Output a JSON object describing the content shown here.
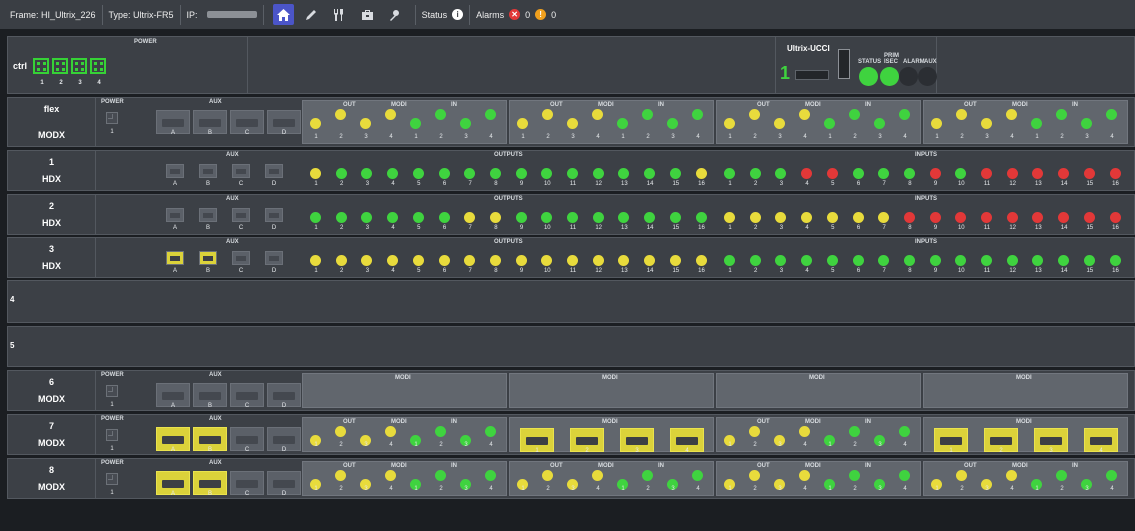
{
  "topbar": {
    "frame": "Frame: HI_Ultrix_226",
    "type": "Type: Ultrix-FR5",
    "ip_label": "IP:",
    "status_label": "Status",
    "alarms_label": "Alarms",
    "alarm_red_count": "0",
    "alarm_yellow_count": "0",
    "tools": [
      "home-icon",
      "pen-icon",
      "wrench-icon",
      "toolbox-icon",
      "tuner-icon"
    ]
  },
  "ctrl": {
    "label": "ctrl",
    "power_label": "POWER",
    "slots": [
      "1",
      "2",
      "3",
      "4"
    ],
    "ucci_title": "Ultrix-UCCI",
    "ucci_number": "1",
    "status_label": "STATUS",
    "prim_label": "PRIM",
    "isec_label": "ISEC",
    "alarm_label": "ALARM",
    "aux_label": "AUX"
  },
  "labels": {
    "power": "POWER",
    "aux": "AUX",
    "out": "OUT",
    "modi": "MODI",
    "in": "IN",
    "outputs": "OUTPUTS",
    "inputs": "INPUTS",
    "bay_letters": [
      "A",
      "B",
      "C",
      "D"
    ]
  },
  "slots": [
    {
      "id": "flex",
      "card": "MODX",
      "kind": "modx",
      "aux": [
        "n",
        "n",
        "n",
        "n"
      ],
      "groups": [
        {
          "kind": "leds",
          "leds": [
            "y",
            "y",
            "y",
            "y",
            "g",
            "g",
            "g",
            "g"
          ]
        },
        {
          "kind": "leds",
          "leds": [
            "y",
            "y",
            "y",
            "y",
            "g",
            "g",
            "g",
            "g"
          ]
        },
        {
          "kind": "leds",
          "leds": [
            "y",
            "y",
            "y",
            "y",
            "g",
            "g",
            "g",
            "g"
          ]
        },
        {
          "kind": "leds",
          "leds": [
            "y",
            "y",
            "y",
            "y",
            "g",
            "g",
            "g",
            "g"
          ]
        }
      ]
    },
    {
      "id": "1",
      "card": "HDX",
      "kind": "hdx",
      "aux": [
        "n",
        "n",
        "n",
        "n"
      ],
      "outputs": [
        "y",
        "g",
        "g",
        "g",
        "g",
        "g",
        "g",
        "g",
        "g",
        "g",
        "g",
        "g",
        "g",
        "g",
        "g",
        "y"
      ],
      "inputs": [
        "g",
        "g",
        "g",
        "r",
        "r",
        "g",
        "g",
        "g",
        "r",
        "g",
        "r",
        "r",
        "r",
        "r",
        "r",
        "r"
      ]
    },
    {
      "id": "2",
      "card": "HDX",
      "kind": "hdx",
      "aux": [
        "n",
        "n",
        "n",
        "n"
      ],
      "outputs": [
        "g",
        "g",
        "g",
        "g",
        "g",
        "g",
        "y",
        "y",
        "g",
        "g",
        "g",
        "g",
        "g",
        "g",
        "g",
        "g"
      ],
      "inputs": [
        "y",
        "y",
        "y",
        "y",
        "y",
        "y",
        "y",
        "r",
        "r",
        "r",
        "r",
        "r",
        "r",
        "r",
        "r",
        "r"
      ]
    },
    {
      "id": "3",
      "card": "HDX",
      "kind": "hdx",
      "aux": [
        "y",
        "y",
        "n",
        "n"
      ],
      "outputs": [
        "y",
        "y",
        "y",
        "y",
        "y",
        "y",
        "y",
        "y",
        "y",
        "y",
        "y",
        "y",
        "y",
        "y",
        "y",
        "y"
      ],
      "inputs": [
        "g",
        "g",
        "g",
        "g",
        "g",
        "g",
        "g",
        "g",
        "g",
        "g",
        "g",
        "g",
        "g",
        "g",
        "g",
        "g"
      ]
    },
    {
      "id": "4",
      "kind": "empty"
    },
    {
      "id": "5",
      "kind": "empty"
    },
    {
      "id": "6",
      "card": "MODX",
      "kind": "modx",
      "aux": [
        "n",
        "n",
        "n",
        "n"
      ],
      "groups": [
        {
          "kind": "blank"
        },
        {
          "kind": "blank"
        },
        {
          "kind": "blank"
        },
        {
          "kind": "blank"
        }
      ]
    },
    {
      "id": "7",
      "card": "MODX",
      "kind": "modx",
      "aux": [
        "y",
        "y",
        "n",
        "n"
      ],
      "groups": [
        {
          "kind": "leds",
          "leds": [
            "y",
            "y",
            "y",
            "y",
            "g",
            "g",
            "g",
            "g"
          ]
        },
        {
          "kind": "bays"
        },
        {
          "kind": "leds",
          "leds": [
            "y",
            "y",
            "y",
            "y",
            "g",
            "g",
            "g",
            "g"
          ]
        },
        {
          "kind": "bays"
        }
      ]
    },
    {
      "id": "8",
      "card": "MODX",
      "kind": "modx",
      "aux": [
        "y",
        "y",
        "n",
        "n"
      ],
      "groups": [
        {
          "kind": "leds",
          "leds": [
            "y",
            "y",
            "y",
            "y",
            "g",
            "g",
            "g",
            "g"
          ]
        },
        {
          "kind": "leds",
          "leds": [
            "y",
            "y",
            "y",
            "y",
            "g",
            "g",
            "g",
            "g"
          ]
        },
        {
          "kind": "leds",
          "leds": [
            "y",
            "y",
            "y",
            "y",
            "g",
            "g",
            "g",
            "g"
          ]
        },
        {
          "kind": "leds",
          "leds": [
            "y",
            "y",
            "y",
            "y",
            "g",
            "g",
            "g",
            "g"
          ]
        }
      ]
    }
  ],
  "colors": {
    "green": "#3fd33f",
    "yellow": "#e8db3c",
    "red": "#e23838",
    "accent": "#4b55c8"
  }
}
